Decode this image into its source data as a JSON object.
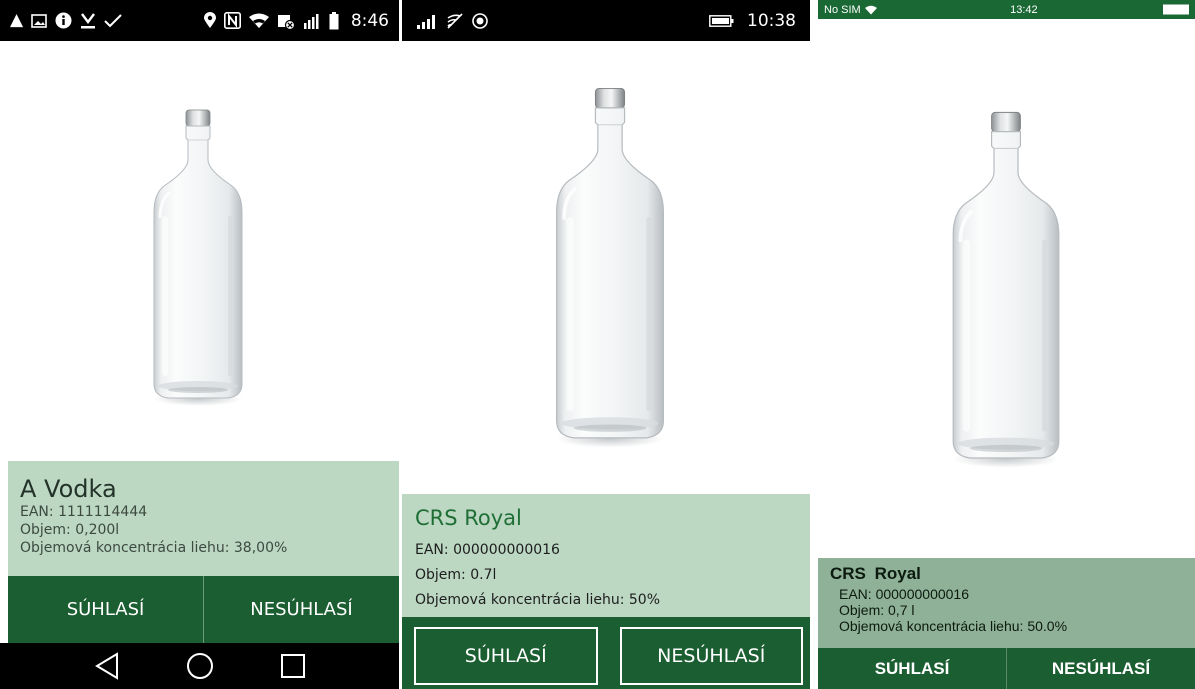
{
  "screens": [
    {
      "status_bar": {
        "time": "8:46"
      },
      "product": {
        "name": "A Vodka",
        "ean": "EAN: 1111114444",
        "volume": "Objem: 0,200l",
        "alcohol": "Objemová koncentrácia liehu: 38,00%"
      },
      "buttons": {
        "agree": "SÚHLASÍ",
        "disagree": "NESÚHLASÍ"
      }
    },
    {
      "status_bar": {
        "time": "10:38"
      },
      "product": {
        "name": "CRS Royal",
        "ean": "EAN: 000000000016",
        "volume": "Objem: 0.7l",
        "alcohol": "Objemová koncentrácia liehu: 50%"
      },
      "buttons": {
        "agree": "SÚHLASÍ",
        "disagree": "NESÚHLASÍ"
      }
    },
    {
      "status_bar": {
        "carrier": "No SIM",
        "time": "13:42"
      },
      "product": {
        "name": "CRS  Royal",
        "ean": "EAN: 000000000016",
        "volume": "Objem: 0,7 l",
        "alcohol": "Objemová koncentrácia liehu: 50.0%"
      },
      "buttons": {
        "agree": "SÚHLASÍ",
        "disagree": "NESÚHLASÍ"
      }
    }
  ],
  "icons": {
    "android_status": [
      "warning-icon",
      "image-icon",
      "info-icon",
      "download-icon",
      "check-icon",
      "location-icon",
      "nfc-icon",
      "wifi-icon",
      "data-off-icon",
      "signal-icon",
      "battery-icon"
    ],
    "android_nav": [
      "back-icon",
      "home-icon",
      "recents-icon"
    ],
    "colors": {
      "brand_green": "#1b5e31",
      "panel_light": "#bcd8c3",
      "panel_mid": "#8fb197"
    }
  }
}
